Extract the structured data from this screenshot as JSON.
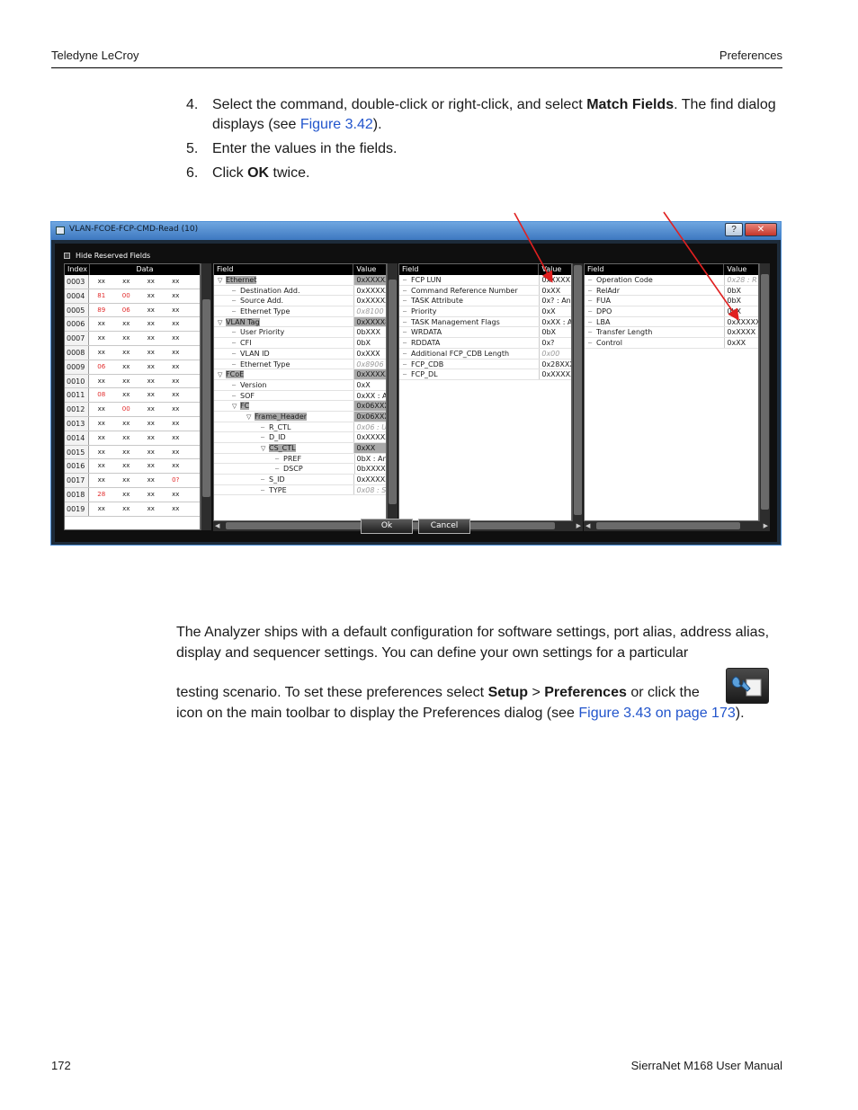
{
  "header": {
    "left": "Teledyne LeCroy",
    "right": "Preferences"
  },
  "footer": {
    "left": "172",
    "right": "SierraNet M168 User Manual"
  },
  "steps": [
    {
      "num": "4.",
      "pre": "Select the command, double-click or right-click, and select ",
      "bold": "Match Fields",
      "mid": ". The find dialog displays (see ",
      "link": "Figure 3.42",
      "post": ")."
    },
    {
      "num": "5.",
      "text": "Enter the values in the fields."
    },
    {
      "num": "6.",
      "pre": "Click ",
      "bold": "OK",
      "post": " twice."
    }
  ],
  "dialog": {
    "title": "VLAN-FCOE-FCP-CMD-Read (10)",
    "help_label": "?",
    "close_label": "✕",
    "checkbox_label": "Hide Reserved Fields",
    "ok_label": "Ok",
    "cancel_label": "Cancel",
    "hex_headers": {
      "index": "Index",
      "data": "Data"
    },
    "hex_rows": [
      {
        "idx": "0003",
        "cells": [
          "xx",
          "xx",
          "xx",
          "xx"
        ],
        "red": []
      },
      {
        "idx": "0004",
        "cells": [
          "81",
          "00",
          "xx",
          "xx"
        ],
        "red": [
          0,
          1
        ]
      },
      {
        "idx": "0005",
        "cells": [
          "89",
          "06",
          "xx",
          "xx"
        ],
        "red": [
          0,
          1
        ]
      },
      {
        "idx": "0006",
        "cells": [
          "xx",
          "xx",
          "xx",
          "xx"
        ],
        "red": []
      },
      {
        "idx": "0007",
        "cells": [
          "xx",
          "xx",
          "xx",
          "xx"
        ],
        "red": []
      },
      {
        "idx": "0008",
        "cells": [
          "xx",
          "xx",
          "xx",
          "xx"
        ],
        "red": []
      },
      {
        "idx": "0009",
        "cells": [
          "06",
          "xx",
          "xx",
          "xx"
        ],
        "red": [
          0
        ]
      },
      {
        "idx": "0010",
        "cells": [
          "xx",
          "xx",
          "xx",
          "xx"
        ],
        "red": []
      },
      {
        "idx": "0011",
        "cells": [
          "08",
          "xx",
          "xx",
          "xx"
        ],
        "red": [
          0
        ]
      },
      {
        "idx": "0012",
        "cells": [
          "xx",
          "00",
          "xx",
          "xx"
        ],
        "red": [
          1
        ]
      },
      {
        "idx": "0013",
        "cells": [
          "xx",
          "xx",
          "xx",
          "xx"
        ],
        "red": []
      },
      {
        "idx": "0014",
        "cells": [
          "xx",
          "xx",
          "xx",
          "xx"
        ],
        "red": []
      },
      {
        "idx": "0015",
        "cells": [
          "xx",
          "xx",
          "xx",
          "xx"
        ],
        "red": []
      },
      {
        "idx": "0016",
        "cells": [
          "xx",
          "xx",
          "xx",
          "xx"
        ],
        "red": []
      },
      {
        "idx": "0017",
        "cells": [
          "xx",
          "xx",
          "xx",
          "0?"
        ],
        "red": [
          3
        ]
      },
      {
        "idx": "0018",
        "cells": [
          "28",
          "xx",
          "xx",
          "xx"
        ],
        "red": [
          0
        ]
      },
      {
        "idx": "0019",
        "cells": [
          "xx",
          "xx",
          "xx",
          "xx"
        ],
        "red": []
      }
    ],
    "col_headers": {
      "field": "Field",
      "value": "Value"
    },
    "tree1": [
      {
        "t": "▽",
        "lvl": 0,
        "f": "Ethernet",
        "v": "0xXXXXXX",
        "grp": true
      },
      {
        "lvl": 1,
        "f": "Destination Add.",
        "v": "0xXXXXX"
      },
      {
        "lvl": 1,
        "f": "Source Add.",
        "v": "0xXXXXX"
      },
      {
        "lvl": 1,
        "f": "Ethernet Type",
        "v": "0x8100",
        "dim": true
      },
      {
        "t": "▽",
        "lvl": 0,
        "f": "VLAN Tag",
        "v": "0xXXXX8",
        "grp": true
      },
      {
        "lvl": 1,
        "f": "User Priority",
        "v": "0bXXX"
      },
      {
        "lvl": 1,
        "f": "CFI",
        "v": "0bX"
      },
      {
        "lvl": 1,
        "f": "VLAN ID",
        "v": "0xXXX"
      },
      {
        "lvl": 1,
        "f": "Ethernet Type",
        "v": "0x8906",
        "dim": true
      },
      {
        "t": "▽",
        "lvl": 0,
        "f": "FCoE",
        "v": "0xXXXXX",
        "grp": true
      },
      {
        "lvl": 1,
        "f": "Version",
        "v": "0xX"
      },
      {
        "lvl": 1,
        "f": "SOF",
        "v": "0xXX : Ar"
      },
      {
        "t": "▽",
        "lvl": 1,
        "f": "FC",
        "v": "0x06XXX",
        "grp": true
      },
      {
        "t": "▽",
        "lvl": 2,
        "f": "Frame_Header",
        "v": "0x06XXX",
        "grp": true
      },
      {
        "lvl": 3,
        "f": "R_CTL",
        "v": "0x06 : U",
        "dim": true
      },
      {
        "lvl": 3,
        "f": "D_ID",
        "v": "0xXXXXX"
      },
      {
        "t": "▽",
        "lvl": 3,
        "f": "CS_CTL",
        "v": "0xXX",
        "grp": true
      },
      {
        "lvl": 4,
        "f": "PREF",
        "v": "0bX : An"
      },
      {
        "lvl": 4,
        "f": "DSCP",
        "v": "0bXXXXX"
      },
      {
        "lvl": 3,
        "f": "S_ID",
        "v": "0xXXXXX"
      },
      {
        "lvl": 3,
        "f": "TYPE",
        "v": "0x08 : S",
        "dim": true
      }
    ],
    "tree2": [
      {
        "f": "FCP LUN",
        "v": "0xXXXX"
      },
      {
        "f": "Command Reference Number",
        "v": "0xXX"
      },
      {
        "f": "TASK Attribute",
        "v": "0x? : An"
      },
      {
        "f": "Priority",
        "v": "0xX"
      },
      {
        "f": "TASK Management Flags",
        "v": "0xXX : A"
      },
      {
        "f": "WRDATA",
        "v": "0bX"
      },
      {
        "f": "RDDATA",
        "v": "0x?"
      },
      {
        "f": "Additional FCP_CDB Length",
        "v": "0x00",
        "dim": true
      },
      {
        "f": "FCP_CDB",
        "v": "0x28XXX"
      },
      {
        "f": "FCP_DL",
        "v": "0xXXXXX"
      }
    ],
    "tree3": [
      {
        "f": "Operation Code",
        "v": "0x28 : R",
        "dim": true
      },
      {
        "f": "RelAdr",
        "v": "0bX"
      },
      {
        "f": "FUA",
        "v": "0bX"
      },
      {
        "f": "DPO",
        "v": "0bX"
      },
      {
        "f": "LBA",
        "v": "0xXXXXX"
      },
      {
        "f": "Transfer Length",
        "v": "0xXXXX"
      },
      {
        "f": "Control",
        "v": "0xXX"
      }
    ],
    "arrow_color": "#e02020"
  },
  "body_para1": "The Analyzer ships with a default configuration for software settings, port alias, address alias, display and sequencer settings. You can define your own settings for a particular",
  "body_para2": {
    "pre": "testing scenario. To set these preferences select ",
    "b1": "Setup",
    "mid": " > ",
    "b2": "Preferences",
    "post": " or click the",
    "line2": "icon on the main toolbar to display the Preferences dialog (see ",
    "link": "Figure 3.43 on page 173",
    "end": ")."
  },
  "toolbar_icon": "preferences-wrench-icon"
}
